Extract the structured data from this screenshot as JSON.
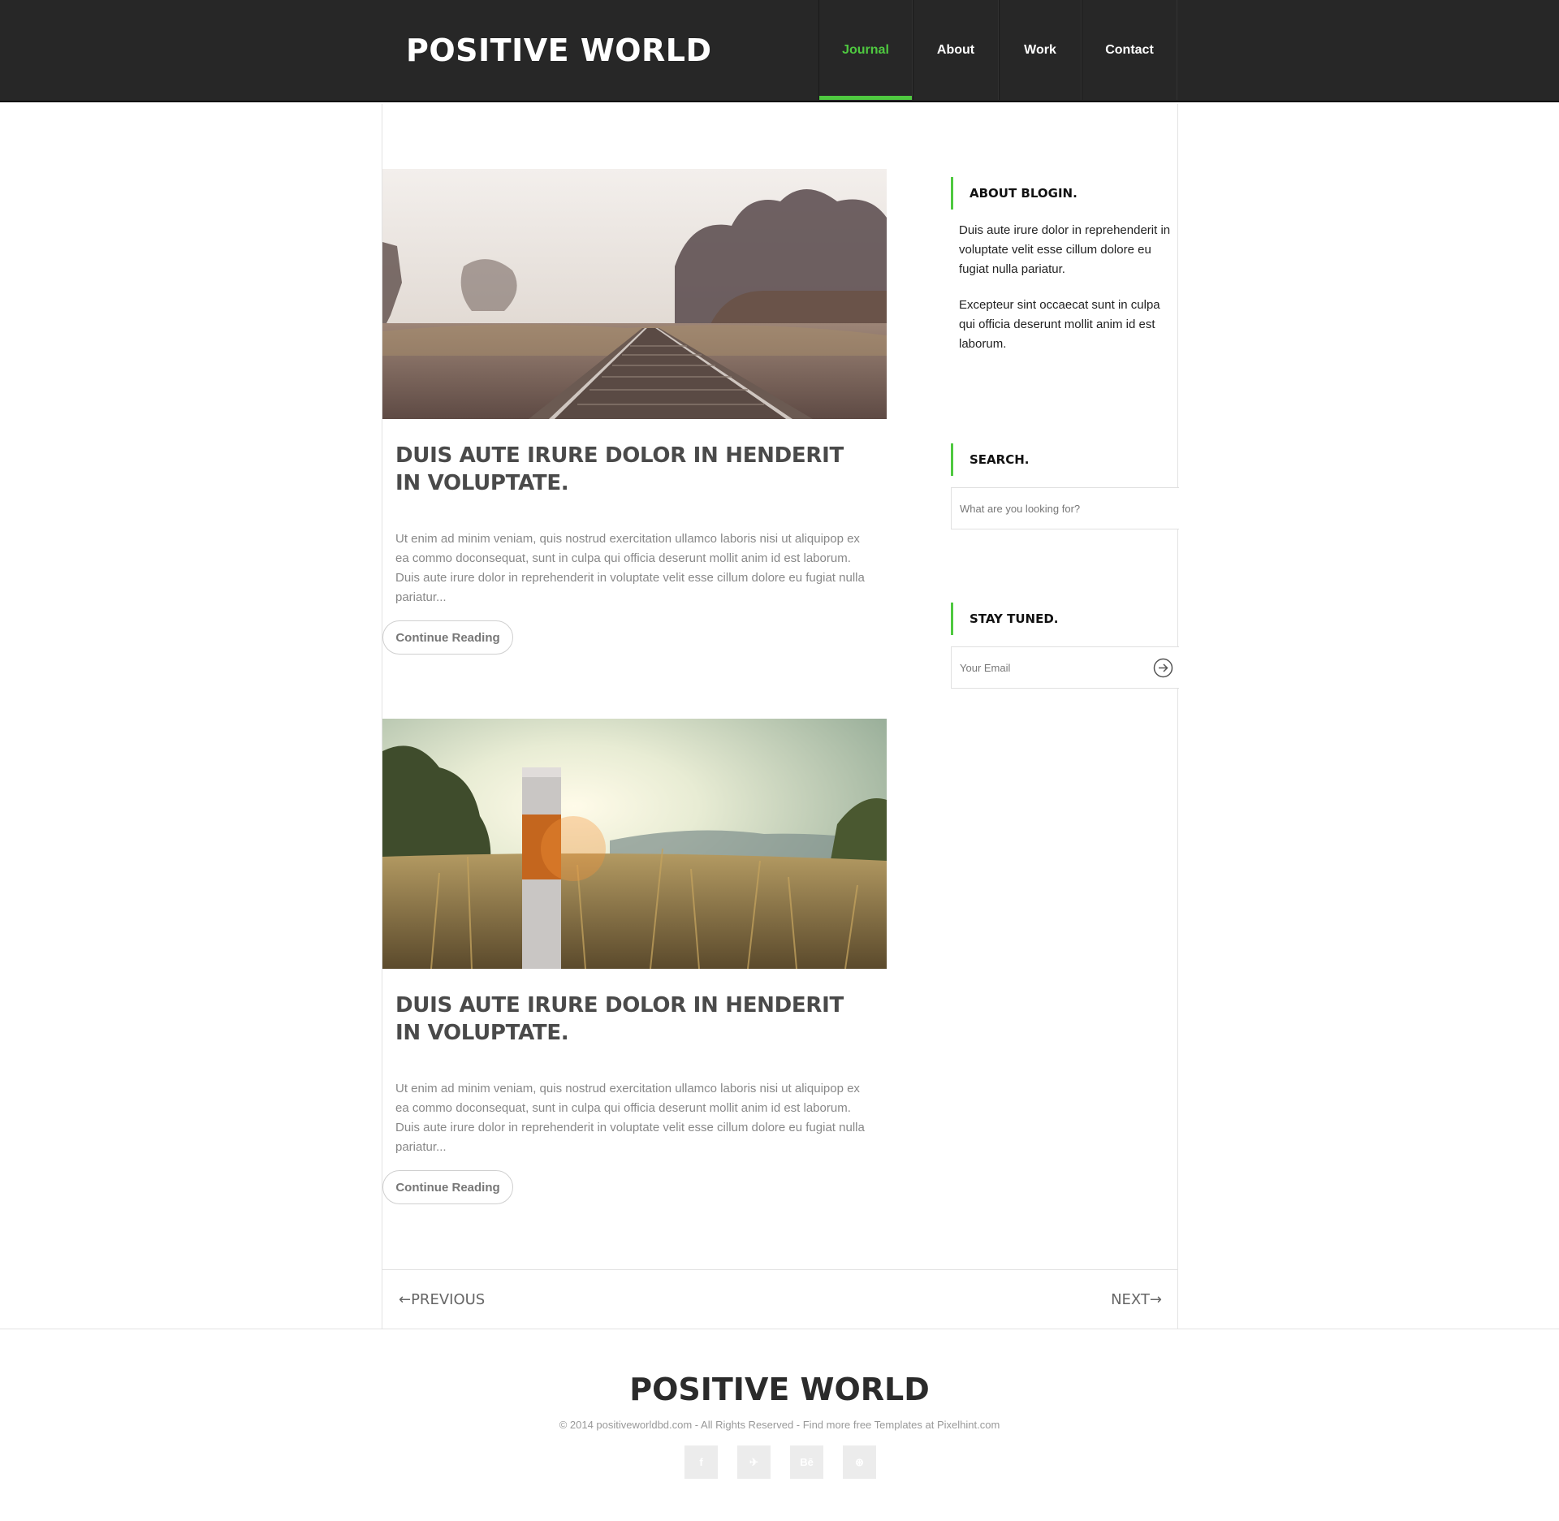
{
  "header": {
    "logo": "POSITIVE WORLD",
    "nav": [
      "Journal",
      "About",
      "Work",
      "Contact"
    ],
    "active_nav": "Journal",
    "accent_color": "#4fc940"
  },
  "posts": [
    {
      "image": "railroad-tracks-photo",
      "title": "DUIS AUTE IRURE DOLOR IN HENDERIT IN VOLUPTATE.",
      "excerpt": "Ut enim ad minim veniam, quis nostrud exercitation ullamco laboris nisi ut aliquipop ex ea commo doconsequat, sunt in culpa qui officia deserunt mollit anim id est laborum. Duis aute irure dolor in reprehenderit in voluptate velit esse cillum dolore eu fugiat nulla pariatur...",
      "button": "Continue Reading"
    },
    {
      "image": "field-post-sunset-photo",
      "title": "DUIS AUTE IRURE DOLOR IN HENDERIT IN VOLUPTATE.",
      "excerpt": "Ut enim ad minim veniam, quis nostrud exercitation ullamco laboris nisi ut aliquipop ex ea commo doconsequat, sunt in culpa qui officia deserunt mollit anim id est laborum. Duis aute irure dolor in reprehenderit in voluptate velit esse cillum dolore eu fugiat nulla pariatur...",
      "button": "Continue Reading"
    }
  ],
  "sidebar": {
    "about": {
      "title": "ABOUT BLOGIN.",
      "paragraphs": [
        "Duis aute irure dolor in reprehenderit in voluptate velit esse cillum dolore eu fugiat nulla pariatur.",
        "Excepteur sint occaecat sunt in culpa qui officia deserunt mollit anim id est laborum."
      ]
    },
    "search": {
      "title": "SEARCH.",
      "placeholder": "What are you looking for?"
    },
    "newsletter": {
      "title": "STAY TUNED.",
      "placeholder": "Your Email",
      "submit_icon": "arrow-right-circle-icon"
    }
  },
  "pager": {
    "previous": "←PREVIOUS",
    "next": "NEXT→"
  },
  "footer": {
    "logo": "POSITIVE WORLD",
    "copyright": "© 2014 positiveworldbd.com - All Rights Reserved - Find more free Templates at Pixelhint.com",
    "social": [
      {
        "icon": "facebook-icon",
        "glyph": "f"
      },
      {
        "icon": "twitter-icon",
        "glyph": "✈"
      },
      {
        "icon": "behance-icon",
        "glyph": "Bē"
      },
      {
        "icon": "dribbble-icon",
        "glyph": "⊛"
      }
    ]
  }
}
